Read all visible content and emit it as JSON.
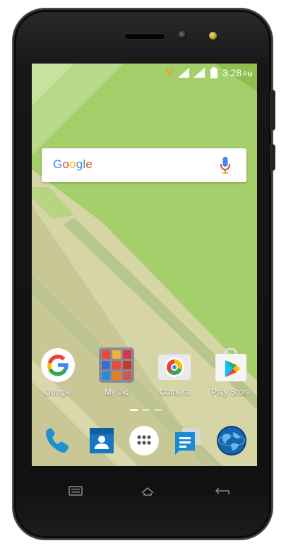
{
  "status_bar": {
    "carrier_glyph": "V",
    "time": "3:28",
    "ampm": "PM"
  },
  "search": {
    "logo_text": "Google"
  },
  "apps": [
    {
      "label": "Google",
      "icon": "google-icon"
    },
    {
      "label": "My Jio",
      "icon": "my-jio-folder-icon"
    },
    {
      "label": "Camera",
      "icon": "camera-icon"
    },
    {
      "label": "Play Store",
      "icon": "play-store-icon"
    }
  ],
  "page_indicator": {
    "pages": 3,
    "current": 1
  },
  "dock": [
    {
      "icon": "phone-icon"
    },
    {
      "icon": "contacts-icon"
    },
    {
      "icon": "app-drawer-icon"
    },
    {
      "icon": "messages-icon"
    },
    {
      "icon": "browser-globe-icon"
    }
  ],
  "nav_buttons": [
    {
      "icon": "menu-icon"
    },
    {
      "icon": "home-icon"
    },
    {
      "icon": "back-icon"
    }
  ],
  "colors": {
    "wallpaper_green": "#a5cf6a",
    "carrier_orange": "#f29b1e",
    "google_blue": "#4285F4",
    "google_red": "#EA4335",
    "google_yellow": "#FBBC05",
    "google_green": "#34A853"
  }
}
